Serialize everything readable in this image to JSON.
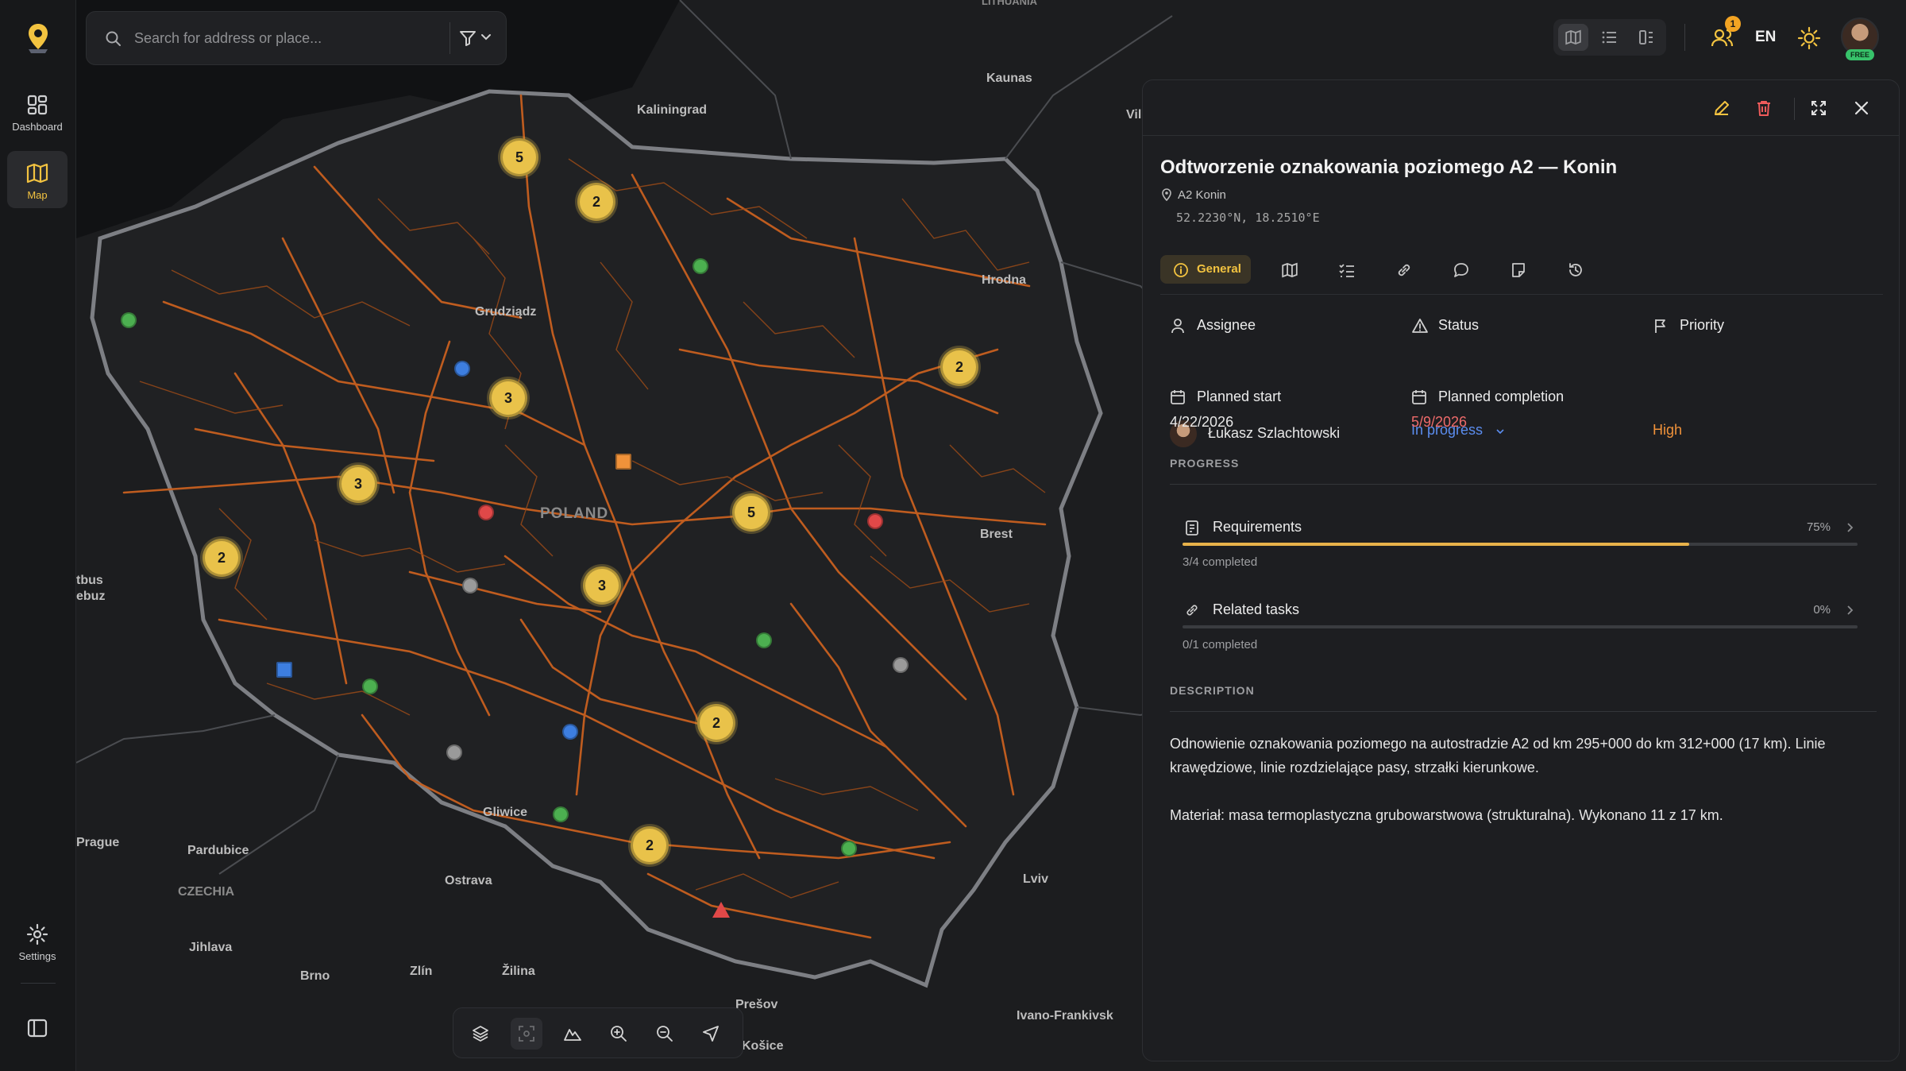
{
  "sidebar": {
    "items": [
      {
        "label": "Dashboard",
        "icon": "dashboard-icon"
      },
      {
        "label": "Map",
        "icon": "map-icon",
        "active": true
      }
    ],
    "settings_label": "Settings"
  },
  "search": {
    "placeholder": "Search for address or place..."
  },
  "header": {
    "notification_count": "1",
    "language": "EN",
    "plan_badge": "FREE"
  },
  "map": {
    "country_label": "POLAND",
    "labels": [
      "Kaliningrad",
      "Kaunas",
      "Vil",
      "Hrodna",
      "Brest",
      "Grudziądz",
      "Prague",
      "Pardubice",
      "CZECHIA",
      "Jihlava",
      "Brno",
      "Zlín",
      "Žilina",
      "Ostrava",
      "Gliwice",
      "Prešov",
      "Košice",
      "Lviv",
      "Ivano-Frankivsk",
      "tbus",
      "ebuz",
      "LITHUANIA"
    ],
    "clusters": [
      "5",
      "2",
      "2",
      "3",
      "3",
      "5",
      "2",
      "3",
      "2",
      "2"
    ]
  },
  "panel": {
    "title": "Odtworzenie oznakowania poziomego A2 — Konin",
    "location": "A2 Konin",
    "coords": "52.2230°N, 18.2510°E",
    "tabs": [
      "General",
      "Map",
      "Checklist",
      "Links",
      "Comments",
      "Notes",
      "History"
    ],
    "assignee_label": "Assignee",
    "assignee_name": "Łukasz Szlachtowski",
    "status_label": "Status",
    "status_value": "In progress",
    "priority_label": "Priority",
    "priority_value": "High",
    "planned_start_label": "Planned start",
    "planned_start_value": "4/22/2026",
    "planned_completion_label": "Planned completion",
    "planned_completion_value": "5/9/2026",
    "progress_heading": "PROGRESS",
    "progress": [
      {
        "title": "Requirements",
        "percent": "75%",
        "fraction": 0.75,
        "sub": "3/4 completed"
      },
      {
        "title": "Related tasks",
        "percent": "0%",
        "fraction": 0,
        "sub": "0/1 completed"
      }
    ],
    "description_heading": "DESCRIPTION",
    "description_p1": "Odnowienie oznakowania poziomego na autostradzie A2 od km 295+000 do km 312+000 (17 km). Linie krawędziowe, linie rozdzielające pasy, strzałki kierunkowe.",
    "description_p2": "Materiał: masa termoplastyczna grubowarstwowa (strukturalna). Wykonano 11 z 17 km."
  },
  "colors": {
    "accent": "#f3c340",
    "status": "#5b8def",
    "priority_high": "#f0923a",
    "overdue": "#ef6b6b",
    "roads": "#c8601f"
  }
}
